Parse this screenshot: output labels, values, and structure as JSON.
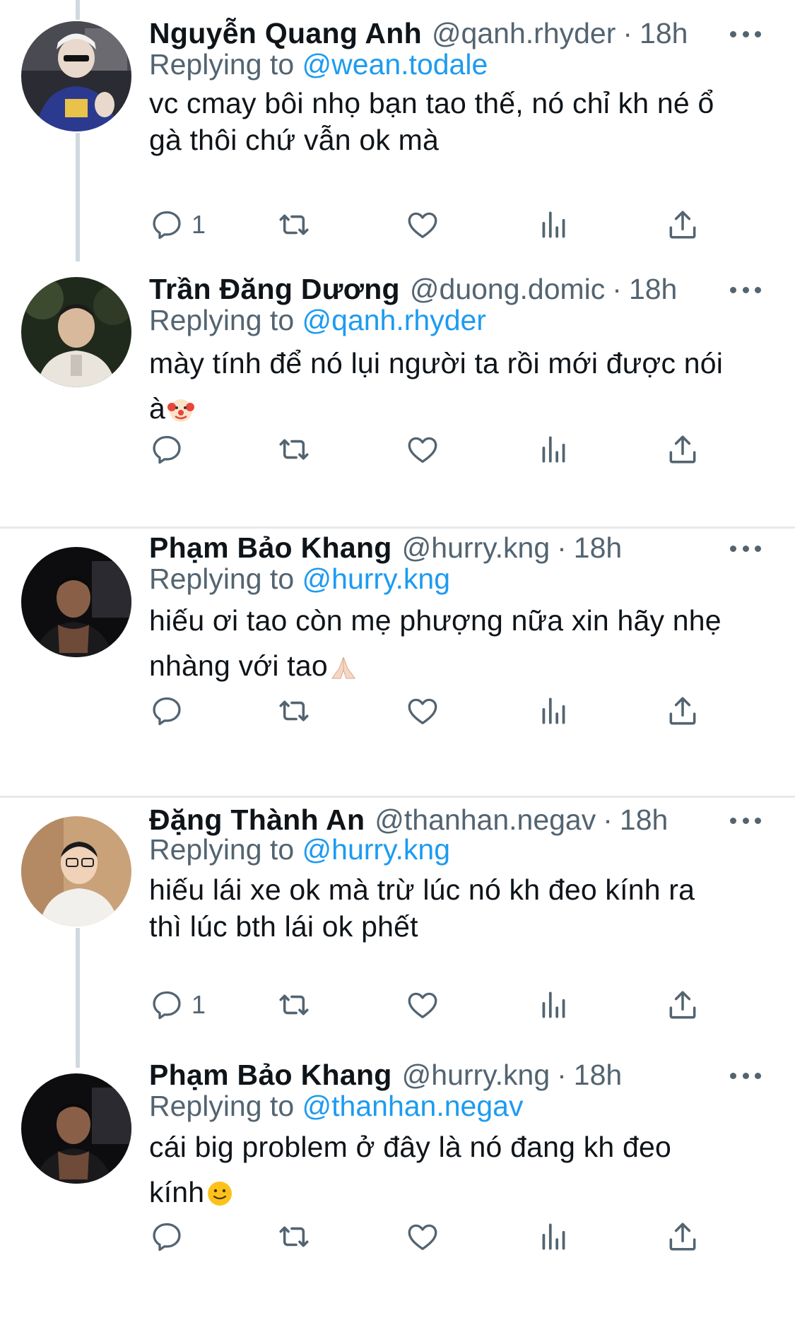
{
  "colors": {
    "link": "#1d9bf0",
    "secondary": "#536471",
    "text": "#0f1419",
    "thread_line": "#cfd9de"
  },
  "labels": {
    "replying_to": "Replying to",
    "separator": "·"
  },
  "tweets": [
    {
      "name": "Nguyễn Quang Anh",
      "handle": "@qanh.rhyder",
      "time": "18h",
      "replying_to": "@wean.todale",
      "lines": [
        "vc cmay bôi nhọ bạn tao thế, nó chỉ kh né ổ",
        "gà thôi chứ vẫn ok mà"
      ],
      "emoji": "",
      "reply_count": "1"
    },
    {
      "name": "Trần Đăng Dương",
      "handle": "@duong.domic",
      "time": "18h",
      "replying_to": "@qanh.rhyder",
      "lines": [
        "mày tính để nó lụi người ta rồi mới được nói",
        "à"
      ],
      "emoji": "clown-face",
      "reply_count": ""
    },
    {
      "name": "Phạm Bảo Khang",
      "handle": "@hurry.kng",
      "time": "18h",
      "replying_to": "@hurry.kng",
      "lines": [
        "hiếu ơi tao còn mẹ phượng nữa xin hãy nhẹ",
        "nhàng với tao"
      ],
      "emoji": "folded-hands",
      "reply_count": ""
    },
    {
      "name": "Đặng Thành An",
      "handle": "@thanhan.negav",
      "time": "18h",
      "replying_to": "@hurry.kng",
      "lines": [
        "hiếu lái xe ok mà trừ lúc nó kh đeo kính ra",
        "thì lúc bth lái ok phết"
      ],
      "emoji": "",
      "reply_count": "1"
    },
    {
      "name": "Phạm Bảo Khang",
      "handle": "@hurry.kng",
      "time": "18h",
      "replying_to": "@thanhan.negav",
      "lines": [
        "cái big problem ở đây là nó đang kh đeo",
        "kính"
      ],
      "emoji": "slightly-smiling-face",
      "reply_count": ""
    }
  ],
  "action_icons": [
    "reply-icon",
    "retweet-icon",
    "like-icon",
    "analytics-icon",
    "share-icon"
  ]
}
